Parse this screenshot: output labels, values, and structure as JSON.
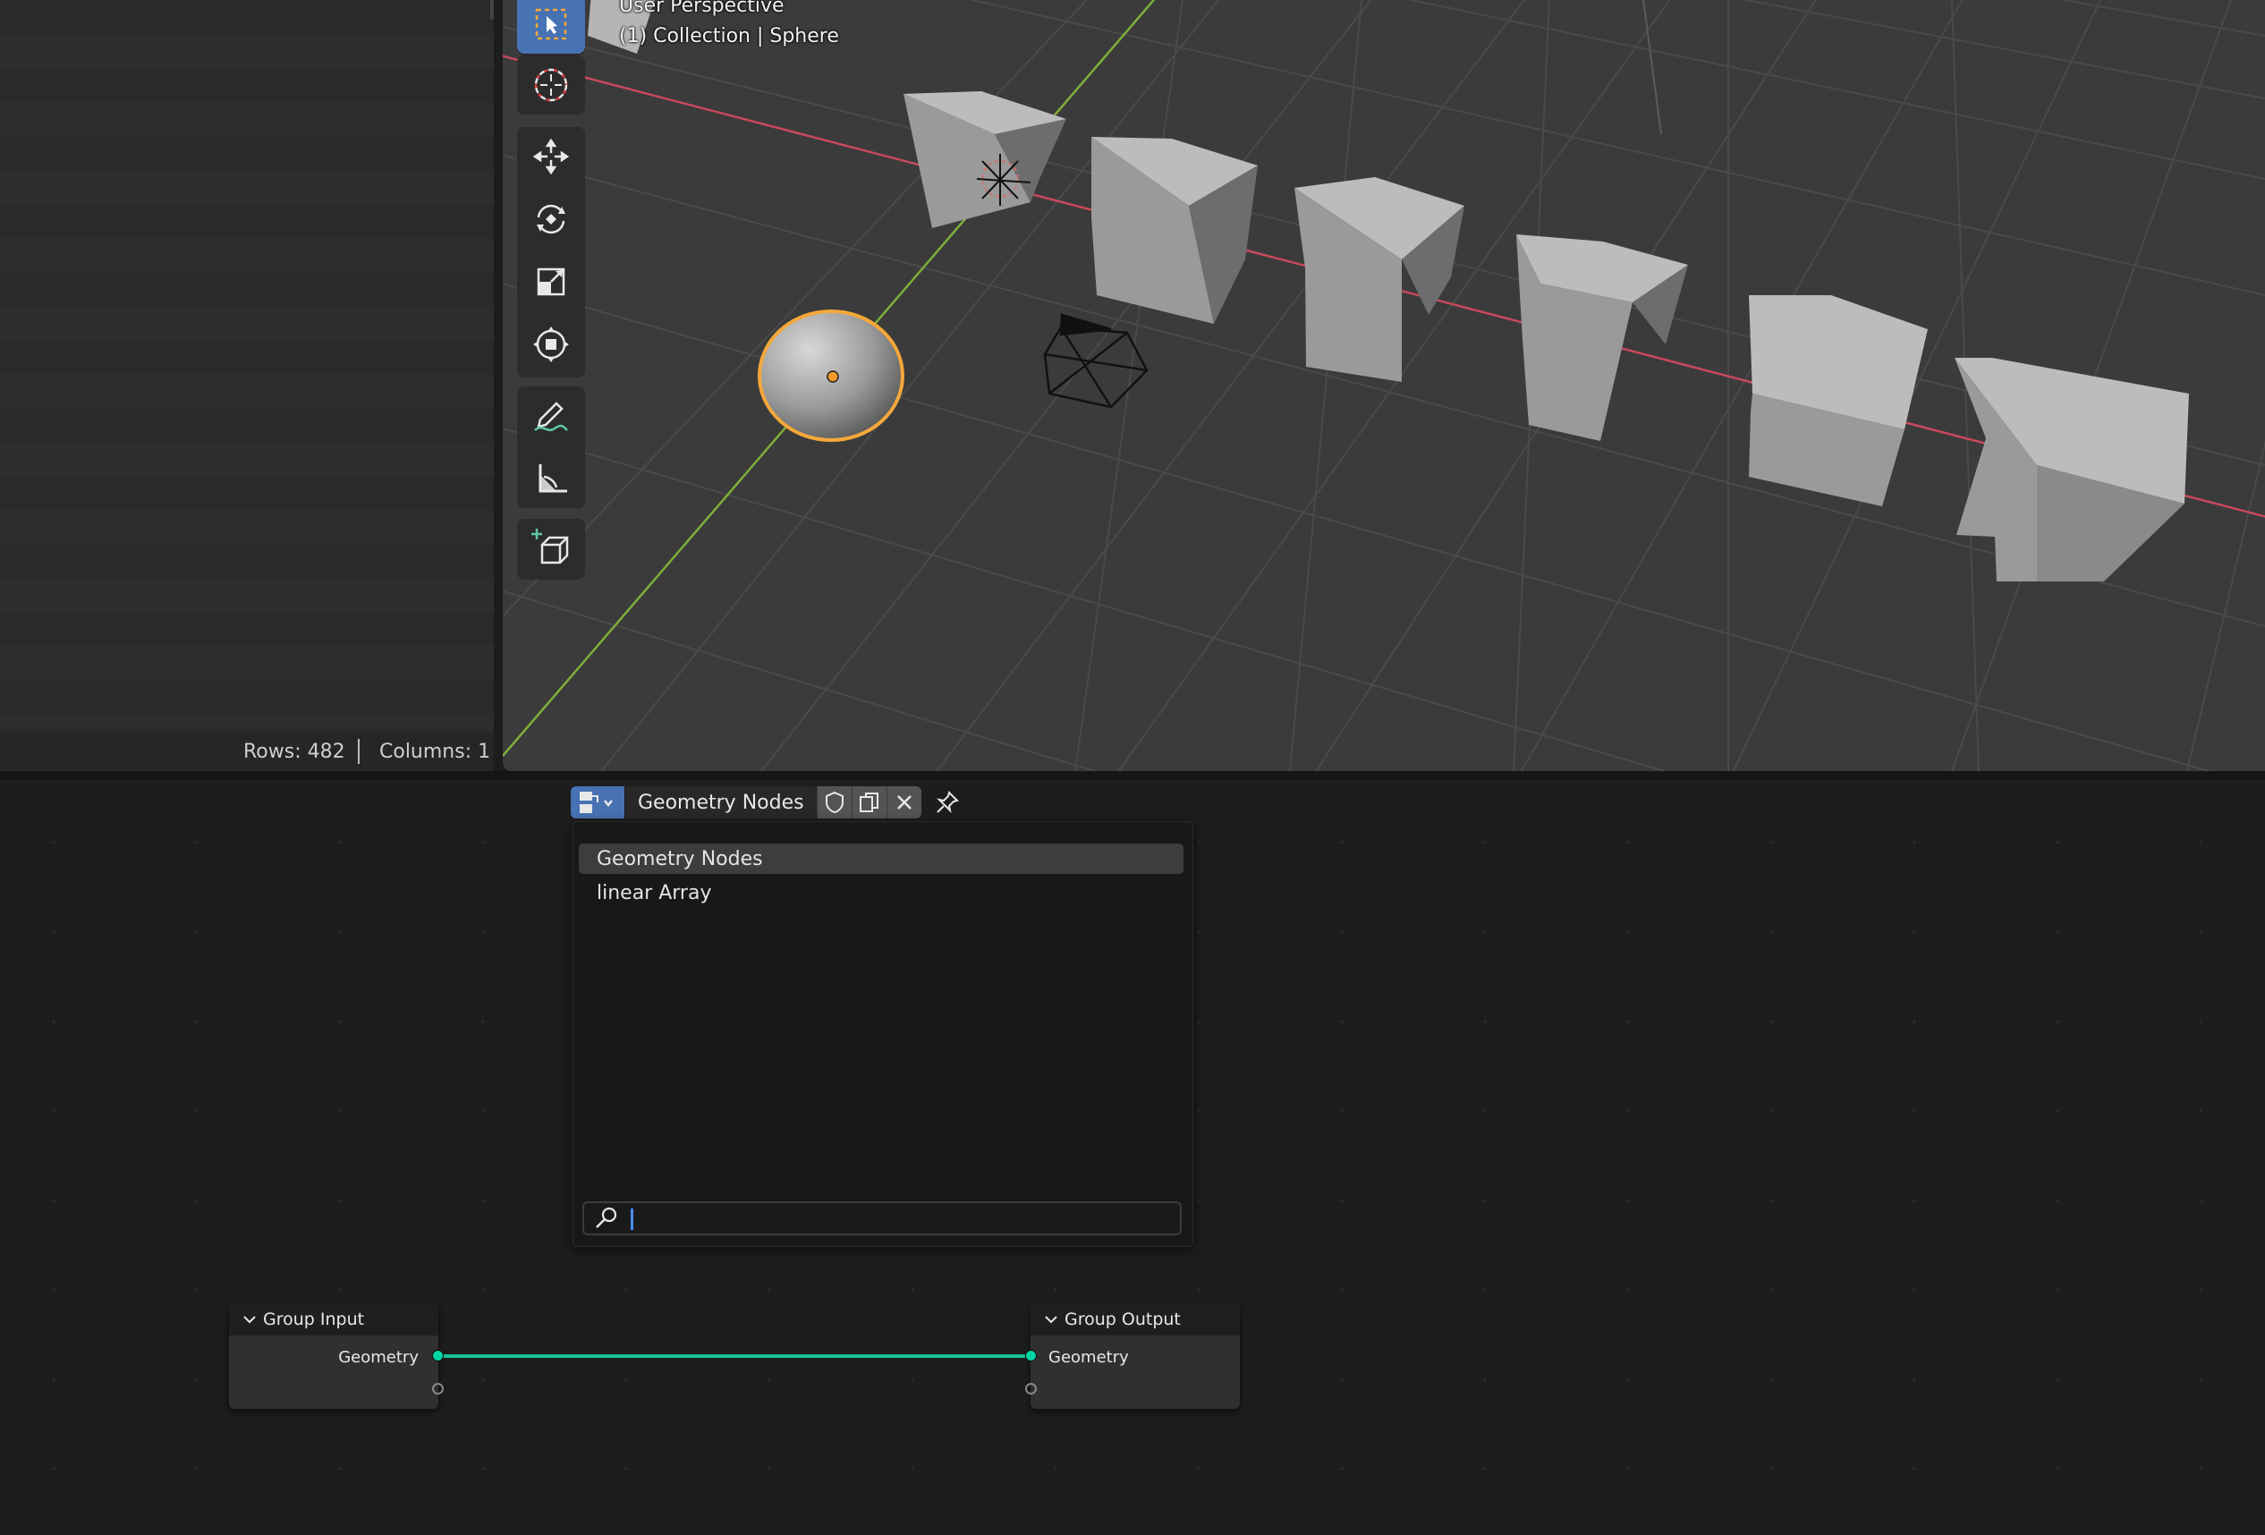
{
  "spreadsheet": {
    "rows_label": "Rows: 482",
    "columns_label": "Columns: 1"
  },
  "viewport": {
    "perspective_label": "User Perspective",
    "collection_label": "(1) Collection | Sphere",
    "toolbar": [
      "select-box",
      "cursor",
      "move",
      "rotate",
      "scale",
      "transform",
      "annotate",
      "measure",
      "add-cube"
    ]
  },
  "node_editor": {
    "datablock_name": "Geometry Nodes",
    "dropdown_items": [
      {
        "label": "Geometry Nodes",
        "selected": true
      },
      {
        "label": "linear Array",
        "selected": false
      }
    ],
    "search_placeholder": "",
    "nodes": {
      "group_input": {
        "title": "Group Input",
        "socket": "Geometry"
      },
      "group_output": {
        "title": "Group Output",
        "socket": "Geometry"
      }
    }
  },
  "colors": {
    "accent": "#4772b3",
    "geometry_socket": "#00d6a3",
    "selection_outline": "#f5a83a",
    "x_axis": "#c74a5a",
    "y_axis": "#7fae3a"
  }
}
